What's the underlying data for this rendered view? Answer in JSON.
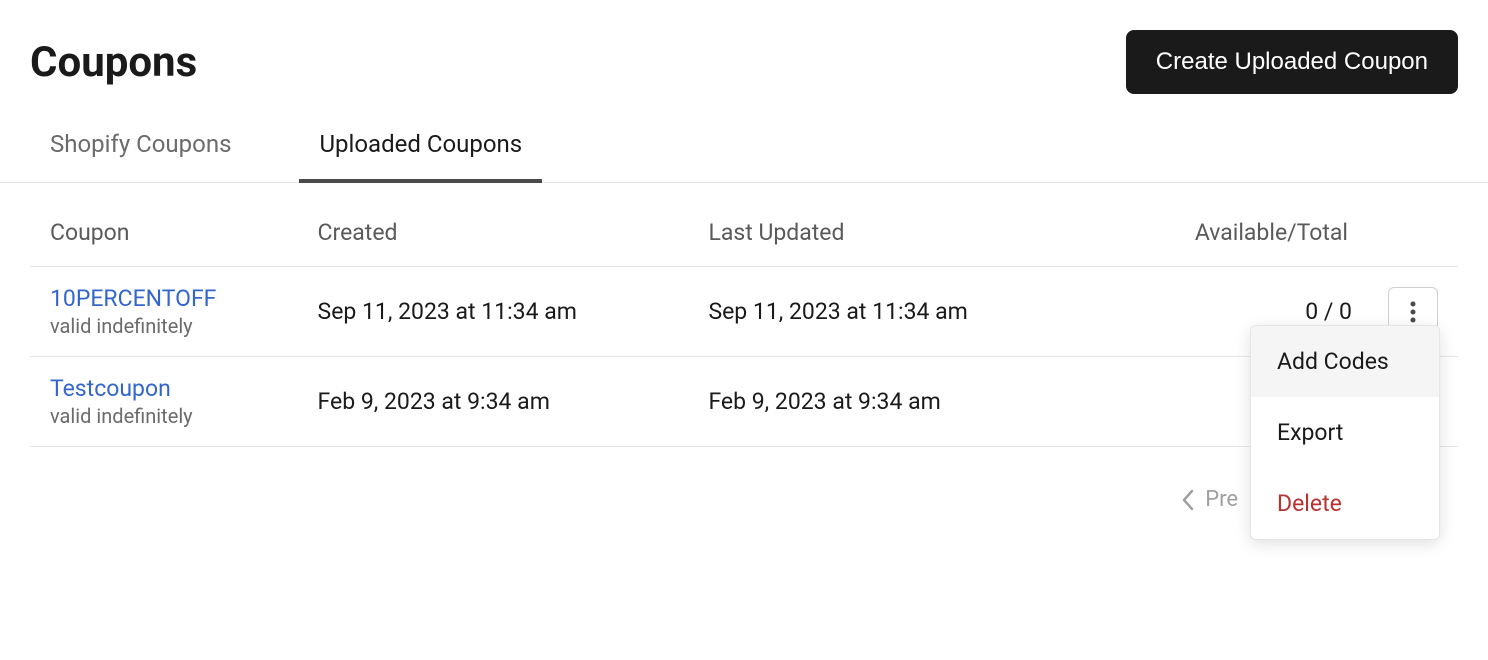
{
  "header": {
    "title": "Coupons",
    "create_label": "Create Uploaded Coupon"
  },
  "tabs": [
    {
      "label": "Shopify Coupons",
      "active": false
    },
    {
      "label": "Uploaded Coupons",
      "active": true
    }
  ],
  "table": {
    "columns": {
      "coupon": "Coupon",
      "created": "Created",
      "updated": "Last Updated",
      "available": "Available/Total"
    },
    "rows": [
      {
        "name": "10PERCENTOFF",
        "validity": "valid indefinitely",
        "created": "Sep 11, 2023 at 11:34 am",
        "updated": "Sep 11, 2023 at 11:34 am",
        "available": "0 / 0"
      },
      {
        "name": "Testcoupon",
        "validity": "valid indefinitely",
        "created": "Feb 9, 2023 at 9:34 am",
        "updated": "Feb 9, 2023 at 9:34 am",
        "available": ""
      }
    ]
  },
  "dropdown": {
    "add_codes": "Add Codes",
    "export": "Export",
    "delete": "Delete"
  },
  "pagination": {
    "prev": "Pre"
  }
}
